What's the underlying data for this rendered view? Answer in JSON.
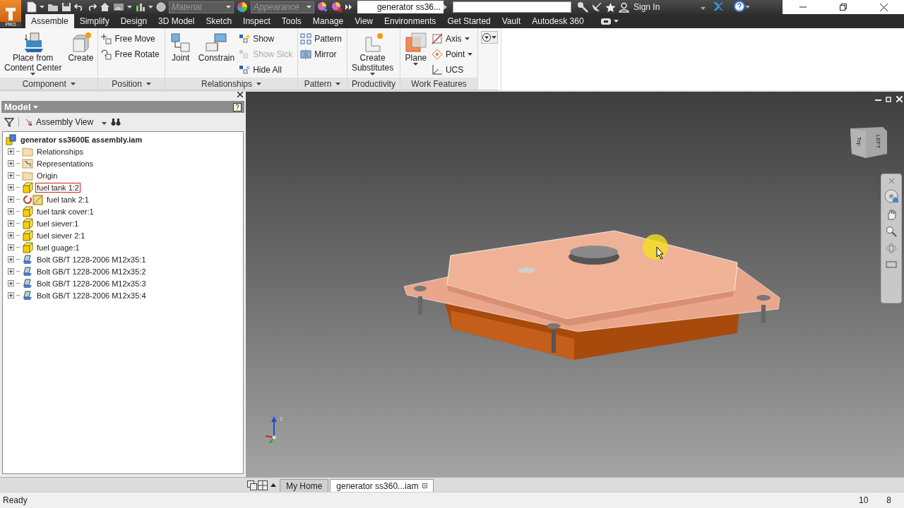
{
  "app": {
    "badge": "PRO"
  },
  "quick_access": {
    "material": "Material",
    "appearance": "Appearance"
  },
  "title_bar": {
    "document": "generator ss36...",
    "sign_in": "Sign In"
  },
  "menu_tabs": [
    {
      "label": "Assemble",
      "selected": true
    },
    {
      "label": "Simplify",
      "selected": false
    },
    {
      "label": "Design",
      "selected": false
    },
    {
      "label": "3D Model",
      "selected": false
    },
    {
      "label": "Sketch",
      "selected": false
    },
    {
      "label": "Inspect",
      "selected": false
    },
    {
      "label": "Tools",
      "selected": false
    },
    {
      "label": "Manage",
      "selected": false
    },
    {
      "label": "View",
      "selected": false
    },
    {
      "label": "Environments",
      "selected": false
    },
    {
      "label": "Get Started",
      "selected": false
    },
    {
      "label": "Vault",
      "selected": false
    },
    {
      "label": "Autodesk 360",
      "selected": false
    }
  ],
  "ribbon": {
    "panels": [
      {
        "title": "Component",
        "menu": true,
        "tools": [
          {
            "kind": "large",
            "lines": [
              "Place from",
              "Content Center"
            ],
            "menu": true
          },
          {
            "kind": "large",
            "lines": [
              "Create"
            ],
            "menu": false
          }
        ]
      },
      {
        "title": "Position",
        "menu": true,
        "tools": [
          {
            "kind": "small",
            "lines": [
              "Free Move"
            ],
            "menu": false,
            "disabled": false
          },
          {
            "kind": "small",
            "lines": [
              "Free Rotate"
            ],
            "menu": false,
            "disabled": false
          }
        ]
      },
      {
        "title": "Relationships",
        "menu": true,
        "tools": [
          {
            "kind": "large",
            "lines": [
              "Joint"
            ],
            "menu": false
          },
          {
            "kind": "large",
            "lines": [
              "Constrain"
            ],
            "menu": false
          },
          {
            "kind": "small",
            "lines": [
              "Show"
            ],
            "menu": false,
            "disabled": false
          },
          {
            "kind": "small",
            "lines": [
              "Show Sick"
            ],
            "menu": false,
            "disabled": true
          },
          {
            "kind": "small",
            "lines": [
              "Hide All"
            ],
            "menu": false,
            "disabled": false
          }
        ]
      },
      {
        "title": "Pattern",
        "menu": true,
        "tools": [
          {
            "kind": "small",
            "lines": [
              "Pattern"
            ],
            "menu": false,
            "disabled": false
          },
          {
            "kind": "small",
            "lines": [
              "Mirror"
            ],
            "menu": false,
            "disabled": false
          }
        ]
      },
      {
        "title": "Productivity",
        "menu": false,
        "tools": [
          {
            "kind": "large",
            "lines": [
              "Create",
              "Substitutes"
            ],
            "menu": true
          }
        ]
      },
      {
        "title": "Work Features",
        "menu": false,
        "tools": [
          {
            "kind": "large",
            "lines": [
              "Plane"
            ],
            "menu": true
          },
          {
            "kind": "small",
            "lines": [
              "Axis"
            ],
            "menu": true,
            "disabled": false
          },
          {
            "kind": "small",
            "lines": [
              "Point"
            ],
            "menu": true,
            "disabled": false
          },
          {
            "kind": "small",
            "lines": [
              "UCS"
            ],
            "menu": false,
            "disabled": false
          }
        ]
      }
    ]
  },
  "browser": {
    "title": "Model",
    "view": "Assembly View",
    "root": {
      "label": "generator ss3600E assembly.iam",
      "children": [
        {
          "label": "Relationships",
          "kind": "folder",
          "expanded": false,
          "selected": false
        },
        {
          "label": "Representations",
          "kind": "representations",
          "expanded": false,
          "selected": false
        },
        {
          "label": "Origin",
          "kind": "folder",
          "expanded": false,
          "selected": false
        },
        {
          "label": "fuel tank 1:2",
          "kind": "part",
          "expanded": false,
          "selected": true
        },
        {
          "label": "fuel tank 2:1",
          "kind": "replaced",
          "expanded": false,
          "selected": false
        },
        {
          "label": "fuel tank cover:1",
          "kind": "part",
          "expanded": false,
          "selected": false
        },
        {
          "label": "fuel siever:1",
          "kind": "part",
          "expanded": false,
          "selected": false
        },
        {
          "label": "fuel siever 2:1",
          "kind": "part",
          "expanded": false,
          "selected": false
        },
        {
          "label": "fuel guage:1",
          "kind": "part",
          "expanded": false,
          "selected": false
        },
        {
          "label": "Bolt GB/T 1228-2006 M12x35:1",
          "kind": "bolt",
          "expanded": false,
          "selected": false
        },
        {
          "label": "Bolt GB/T 1228-2006 M12x35:2",
          "kind": "bolt",
          "expanded": false,
          "selected": false
        },
        {
          "label": "Bolt GB/T 1228-2006 M12x35:3",
          "kind": "bolt",
          "expanded": false,
          "selected": false
        },
        {
          "label": "Bolt GB/T 1228-2006 M12x35:4",
          "kind": "bolt",
          "expanded": false,
          "selected": false
        }
      ]
    }
  },
  "viewport": {
    "viewcube_faces": [
      "Top",
      "LEFT"
    ],
    "axis_label": "z"
  },
  "document_tabs": [
    {
      "label": "My Home",
      "selected": false
    },
    {
      "label": "generator ss360...iam",
      "selected": true
    }
  ],
  "status_bar": {
    "message": "Ready",
    "readouts": [
      "10",
      "8"
    ]
  }
}
